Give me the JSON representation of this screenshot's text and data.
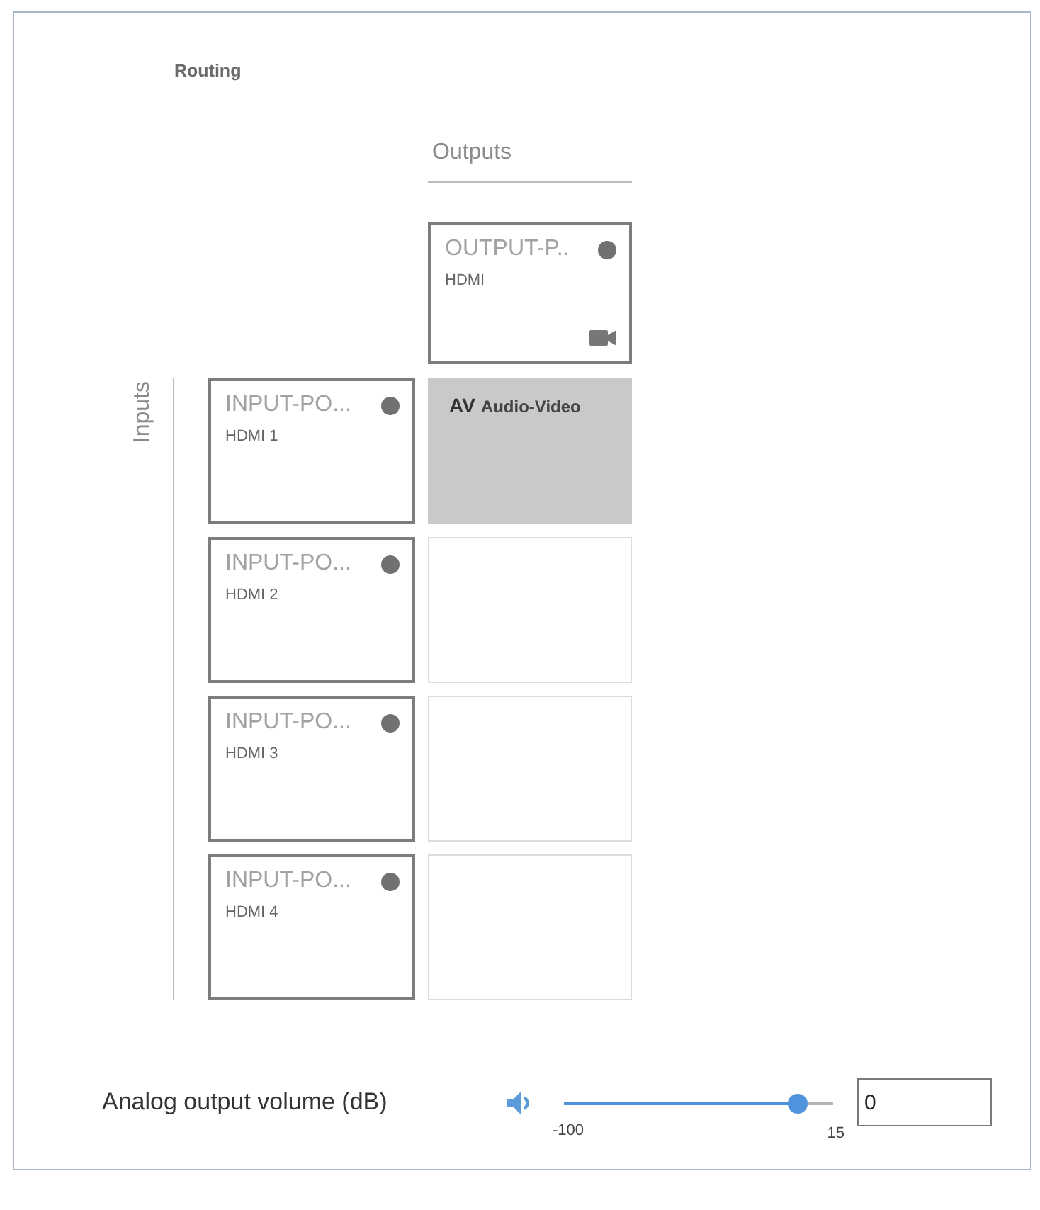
{
  "section": {
    "title": "Routing"
  },
  "outputs": {
    "heading": "Outputs",
    "items": [
      {
        "name": "OUTPUT-P..",
        "port": "HDMI"
      }
    ]
  },
  "inputs": {
    "heading": "Inputs",
    "items": [
      {
        "name": "INPUT-PO...",
        "port": "HDMI 1",
        "crosspoints": [
          {
            "selected": true,
            "code": "AV",
            "label": "Audio-Video"
          }
        ]
      },
      {
        "name": "INPUT-PO...",
        "port": "HDMI 2",
        "crosspoints": [
          {
            "selected": false
          }
        ]
      },
      {
        "name": "INPUT-PO...",
        "port": "HDMI 3",
        "crosspoints": [
          {
            "selected": false
          }
        ]
      },
      {
        "name": "INPUT-PO...",
        "port": "HDMI 4",
        "crosspoints": [
          {
            "selected": false
          }
        ]
      }
    ]
  },
  "volume": {
    "label": "Analog output volume (dB)",
    "min_label": "-100",
    "max_label": "15",
    "level": 0.87,
    "value": "0"
  }
}
